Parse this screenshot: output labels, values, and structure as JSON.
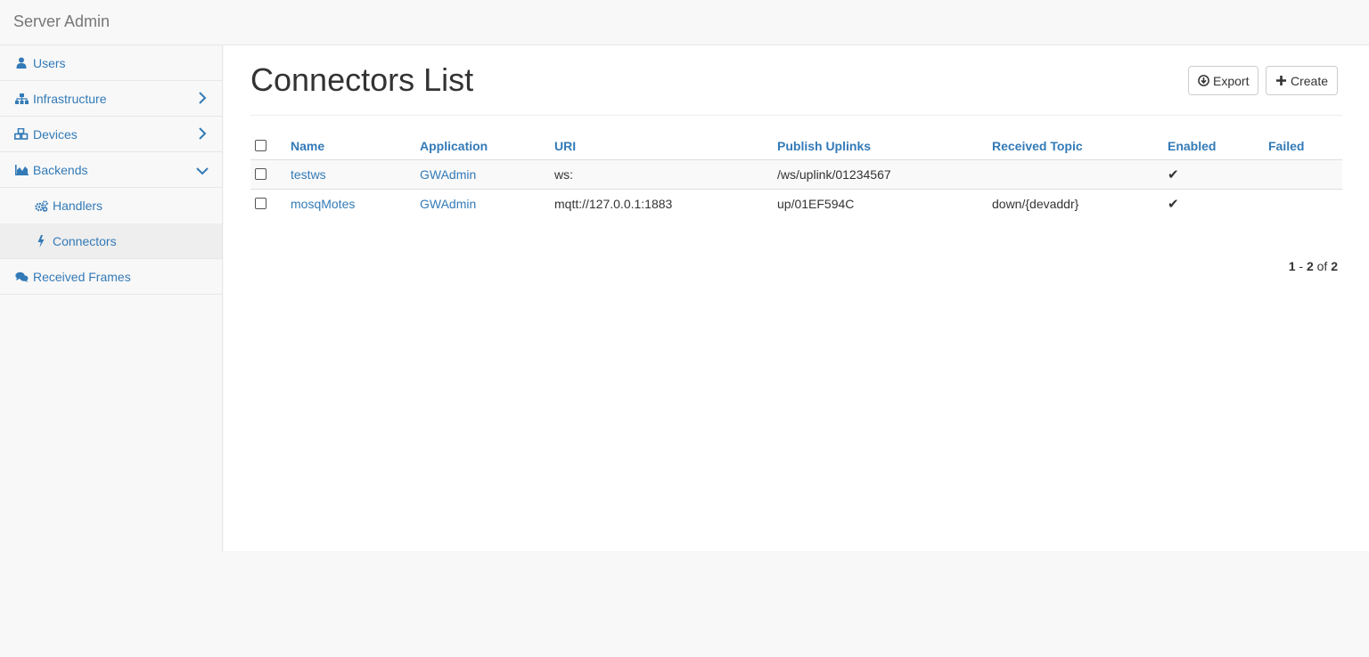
{
  "app": {
    "brand": "Server Admin"
  },
  "sidebar": {
    "items": [
      {
        "label": "Users",
        "icon": "user-icon"
      },
      {
        "label": "Infrastructure",
        "icon": "sitemap-icon",
        "chevron": "right"
      },
      {
        "label": "Devices",
        "icon": "cubes-icon",
        "chevron": "right"
      },
      {
        "label": "Backends",
        "icon": "area-chart-icon",
        "chevron": "down"
      },
      {
        "label": "Handlers",
        "icon": "cogs-icon"
      },
      {
        "label": "Connectors",
        "icon": "bolt-icon",
        "active": true
      },
      {
        "label": "Received Frames",
        "icon": "comments-icon"
      }
    ]
  },
  "main": {
    "title": "Connectors List",
    "export_label": "Export",
    "create_label": "Create",
    "table": {
      "headers": [
        "Name",
        "Application",
        "URI",
        "Publish Uplinks",
        "Received Topic",
        "Enabled",
        "Failed"
      ],
      "rows": [
        {
          "name": "testws",
          "application": "GWAdmin",
          "uri": "ws:",
          "publish_uplinks": "/ws/uplink/01234567",
          "received_topic": "",
          "enabled": "✔",
          "failed": ""
        },
        {
          "name": "mosqMotes",
          "application": "GWAdmin",
          "uri": "mqtt://127.0.0.1:1883",
          "publish_uplinks": "up/01EF594C",
          "received_topic": "down/{devaddr}",
          "enabled": "✔",
          "failed": ""
        }
      ]
    },
    "pagination": {
      "start": "1",
      "sep": " - ",
      "end": "2",
      "of": " of ",
      "total": "2"
    }
  },
  "colors": {
    "link": "#337ab7",
    "sidebar_bg": "#f8f8f8",
    "active_bg": "#eeeeee"
  }
}
